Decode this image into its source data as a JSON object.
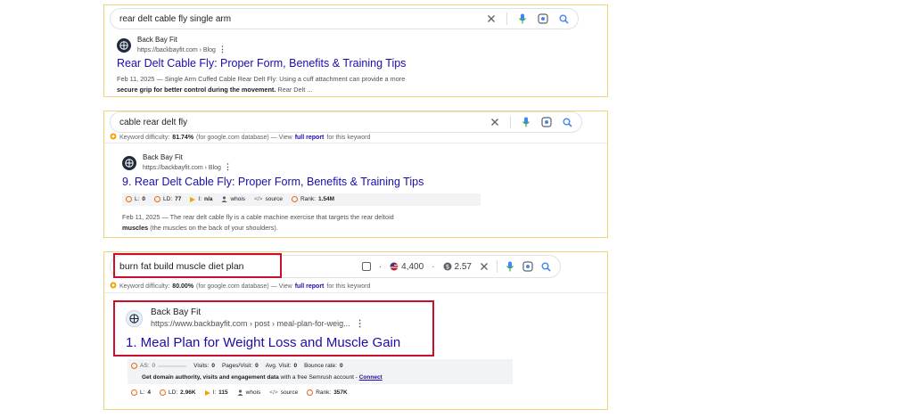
{
  "card1": {
    "query": "rear delt cable fly single arm",
    "site_name": "Back Bay Fit",
    "url": "https://backbayfit.com › Blog",
    "title": "Rear Delt Cable Fly: Proper Form, Benefits & Training Tips",
    "snippet_line1": "Feb 11, 2025 — Single Arm Cuffed Cable Rear Delt Fly: Using a cuff attachment can provide a more",
    "snippet_line2_bold": "secure grip for better control during the movement.",
    "snippet_line2_rest": " Rear Delt ..."
  },
  "card2": {
    "query": "cable rear delt fly",
    "kd_label": "Keyword difficulty:",
    "kd_value": "81.74%",
    "kd_db": "(for google.com database) — View",
    "kd_link": "full report",
    "kd_tail": "for this keyword",
    "site_name": "Back Bay Fit",
    "url": "https://backbayfit.com › Blog",
    "title": "9. Rear Delt Cable Fly: Proper Form, Benefits & Training Tips",
    "metrics": {
      "l_label": "L:",
      "l_value": "0",
      "ld_label": "LD:",
      "ld_value": "77",
      "i_label": "I:",
      "i_value": "n/a",
      "whois": "whois",
      "source": "source",
      "rank_label": "Rank:",
      "rank_value": "1.54M"
    },
    "snippet_line1": "Feb 11, 2025 — The rear delt cable fly is a cable machine exercise that targets the rear deltoid",
    "snippet_line2_bold": "muscles",
    "snippet_line2_rest": " (the muscles on the back of your shoulders)."
  },
  "card3": {
    "query": "burn fat build muscle diet plan",
    "volume": "4,400",
    "cpc": "2.57",
    "kd_label": "Keyword difficulty:",
    "kd_value": "80.00%",
    "kd_db": "(for google.com database) — View",
    "kd_link": "full report",
    "kd_tail": "for this keyword",
    "site_name": "Back Bay Fit",
    "url": "https://www.backbayfit.com › post › meal-plan-for-weig...",
    "title": "1. Meal Plan for Weight Loss and Muscle Gain",
    "stats": {
      "as_label": "AS:",
      "as_value": "0",
      "visits_label": "Visits:",
      "visits_value": "0",
      "pages_label": "Pages/Visit:",
      "pages_value": "0",
      "avg_label": "Avg. Visit:",
      "avg_value": "0",
      "bounce_label": "Bounce rate:",
      "bounce_value": "0"
    },
    "semrush_bold1": "Get domain authority, visits and engagement data",
    "semrush_mid": " with a free Semrush account - ",
    "semrush_link": "Connect",
    "metrics": {
      "l_label": "L:",
      "l_value": "4",
      "ld_label": "LD:",
      "ld_value": "2.96K",
      "i_label": "I:",
      "i_value": "115",
      "whois": "whois",
      "source": "source",
      "rank_label": "Rank:",
      "rank_value": "357K"
    }
  },
  "colors": {
    "panel_border": "#f2d27a",
    "link_title": "#1a0dab",
    "highlight_red": "#c8102e",
    "metric_orange": "#e8681e",
    "mic_blue": "#4285f4"
  },
  "icons": [
    "clear-icon",
    "mic-icon",
    "lens-icon",
    "search-icon",
    "grid-logo-icon",
    "kebab-menu-icon",
    "flag-icon",
    "dollar-icon",
    "ring-metric-icon",
    "triangle-icon",
    "person-icon",
    "code-icon"
  ]
}
